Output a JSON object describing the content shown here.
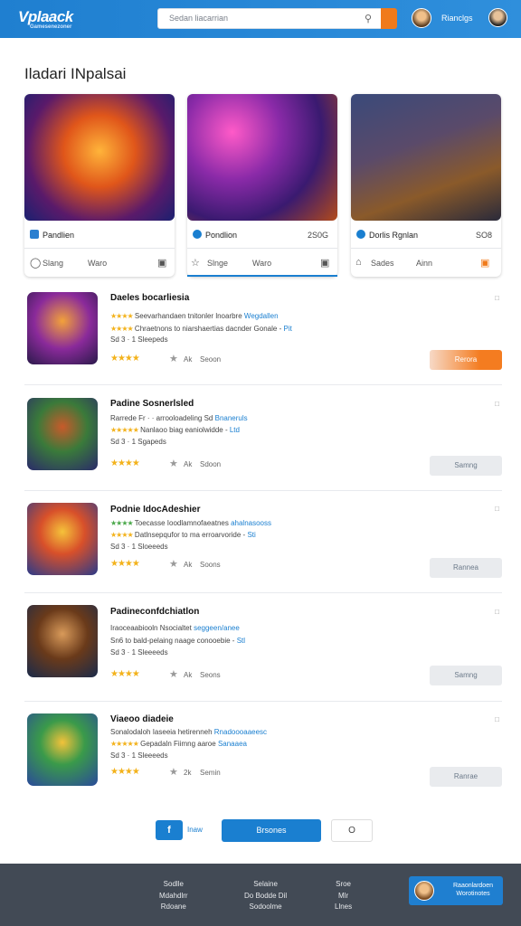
{
  "header": {
    "logo": "Vplaack",
    "logo_sub": "Gamesenezoner",
    "search_placeholder": "Sedan liacarrian",
    "user_name": "Rianclgs",
    "search_icon": "search-icon",
    "colors": {
      "bar": "#1f7fd0",
      "accent": "#f07a1a"
    }
  },
  "section_title": "Iladari INpalsai",
  "featured": [
    {
      "name": "Pandlien",
      "price": "",
      "act1": "Slang",
      "act2": "Waro"
    },
    {
      "name": "Pondlion",
      "price": "2S0G",
      "act1": "Slnge",
      "act2": "Waro"
    },
    {
      "name": "Dorlis Rgnlan",
      "price": "SO8",
      "act1": "Sades",
      "act2": "Ainn"
    }
  ],
  "list": [
    {
      "title": "Daeles bocarliesia",
      "l1": "Seevarhandaen tnitonler lnoarbre",
      "l1link": "Wegdallen",
      "l2": "Chraetnons to niarshaertias dacnder Gonale -",
      "l2link": "Pit",
      "l3": "Sd 3 · 1 Sleepeds",
      "count": "Ak",
      "count2": "Seoon",
      "button": "Rerora",
      "primary": true
    },
    {
      "title": "Padine Sosnerlsled",
      "l1": "Rarrede Fr · · arrooloadeling Sd",
      "l1link": "Bnaneruls",
      "l2": "Nanlaoo biag eaniolwidde -",
      "l2link": "Ltd",
      "l3": "Sd 3 · 1 Sgapeds",
      "count": "Ak",
      "count2": "Sdoon",
      "button": "Samng",
      "primary": false
    },
    {
      "title": "Podnie IdocAdeshier",
      "l1": "Toecasse Ioodlamnofaeatnes",
      "l1link": "ahalnasooss",
      "l2": "Datlnsepqufor to ma erroarvoride -",
      "l2link": "Sti",
      "l3": "Sd 3 · 1 Sloeeeds",
      "count": "Ak",
      "count2": "Soons",
      "button": "Rannea",
      "primary": false
    },
    {
      "title": "Padineconfdchiatlon",
      "l1": "Iraoceaabiooln Nsocialtet",
      "l1link": "seggeen/anee",
      "l2": "Sn6 to bald-pelaing naage conooebie -",
      "l2link": "Stl",
      "l3": "Sd 3 · 1 Sleeeeds",
      "count": "Ak",
      "count2": "Seons",
      "button": "Samng",
      "primary": false
    },
    {
      "title": "Viaeoo diadeie",
      "l1": "Sonalodaloh Iaseeia hetirenneh",
      "l1link": "Rnadoooaaeesc",
      "l2": "Gepadaln Fiimng aaroe",
      "l2link": "Sanaaea",
      "l3": "Sd 3 · 1 Sleeeeds",
      "count": "2k",
      "count2": "Semin",
      "button": "Ranrae",
      "primary": false
    }
  ],
  "pager": {
    "f": "f",
    "prev": "Inaw",
    "next": "Brsones",
    "circle": "O"
  },
  "footer": {
    "col1": [
      "Sodlle",
      "Mdahdlrr",
      "Rdoane"
    ],
    "col2": [
      "Selaine",
      "Do Bodde Dil",
      "Sodoolme"
    ],
    "col3": [
      "Sroe",
      "Mlr",
      "Llnes"
    ],
    "cta": "Raaonlardoen Worotinotes"
  }
}
